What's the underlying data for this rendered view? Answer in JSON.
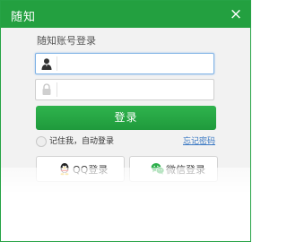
{
  "window": {
    "title": "随知",
    "close_glyph": "×"
  },
  "login": {
    "heading": "随知账号登录",
    "username": {
      "value": "",
      "placeholder": "",
      "icon": "user-icon"
    },
    "password": {
      "value": "",
      "placeholder": "",
      "icon": "lock-icon"
    },
    "submit_label": "登录",
    "remember_label": "记住我，自动登录",
    "remember_checked": false,
    "forgot_label": "忘记密码"
  },
  "social": {
    "qq_label": "QQ登录",
    "qq_icon": "qq-penguin-icon",
    "wechat_label": "微信登录",
    "wechat_icon": "wechat-icon"
  },
  "colors": {
    "brand_green": "#23a040",
    "link_blue": "#3a78c3"
  }
}
